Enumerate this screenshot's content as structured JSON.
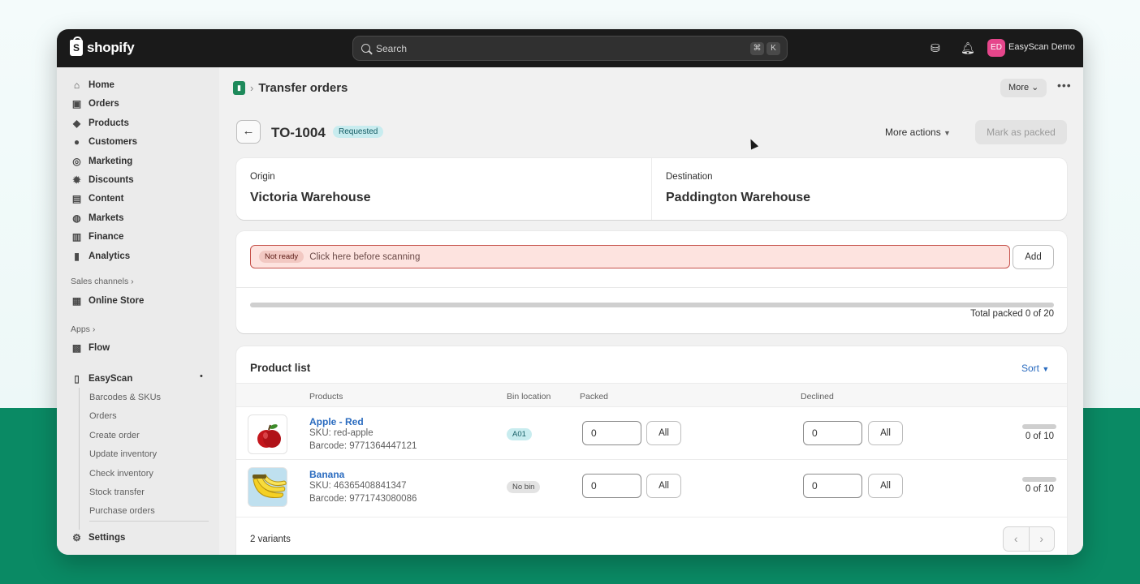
{
  "topbar": {
    "brand": "shopify",
    "search_placeholder": "Search",
    "shortcut_keys": [
      "⌘",
      "K"
    ],
    "store_initials": "ED",
    "store_name": "EasyScan Demo"
  },
  "sidebar": {
    "items": [
      {
        "label": "Home",
        "icon": "home-icon"
      },
      {
        "label": "Orders",
        "icon": "orders-icon"
      },
      {
        "label": "Products",
        "icon": "tag-icon"
      },
      {
        "label": "Customers",
        "icon": "person-icon"
      },
      {
        "label": "Marketing",
        "icon": "target-icon"
      },
      {
        "label": "Discounts",
        "icon": "discount-icon"
      },
      {
        "label": "Content",
        "icon": "content-icon"
      },
      {
        "label": "Markets",
        "icon": "globe-icon"
      },
      {
        "label": "Finance",
        "icon": "bank-icon"
      },
      {
        "label": "Analytics",
        "icon": "chart-icon"
      }
    ],
    "sales_channels_label": "Sales channels",
    "online_store": "Online Store",
    "apps_label": "Apps",
    "flow": "Flow",
    "easyscan": "EasyScan",
    "easyscan_sub": [
      "Barcodes & SKUs",
      "Orders",
      "Create order",
      "Update inventory",
      "Check inventory",
      "Stock transfer",
      "Purchase orders"
    ],
    "settings": "Settings"
  },
  "header": {
    "breadcrumb_title": "Transfer orders",
    "more_label": "More"
  },
  "order": {
    "id": "TO-1004",
    "status": "Requested",
    "more_actions": "More actions",
    "mark_packed": "Mark as packed",
    "origin_label": "Origin",
    "origin_value": "Victoria Warehouse",
    "destination_label": "Destination",
    "destination_value": "Paddington Warehouse"
  },
  "scanner": {
    "status_badge": "Not ready",
    "placeholder": "Click here before scanning",
    "add_label": "Add",
    "packed_fraction": 0,
    "total_text": "Total packed 0 of 20"
  },
  "product_list": {
    "title": "Product list",
    "sort_label": "Sort",
    "columns": [
      "Products",
      "Bin location",
      "Packed",
      "Declined"
    ],
    "rows": [
      {
        "name": "Apple - Red",
        "sku": "SKU: red-apple",
        "barcode": "Barcode: 9771364447121",
        "bin": "A01",
        "packed": "0",
        "declined": "0",
        "all_label": "All",
        "progress_text": "0 of 10",
        "progress_fraction": 0
      },
      {
        "name": "Banana",
        "sku": "SKU: 46365408841347",
        "barcode": "Barcode: 9771743080086",
        "bin": "No bin",
        "packed": "0",
        "declined": "0",
        "all_label": "All",
        "progress_text": "0 of 10",
        "progress_fraction": 0
      }
    ],
    "footer": "2 variants"
  }
}
